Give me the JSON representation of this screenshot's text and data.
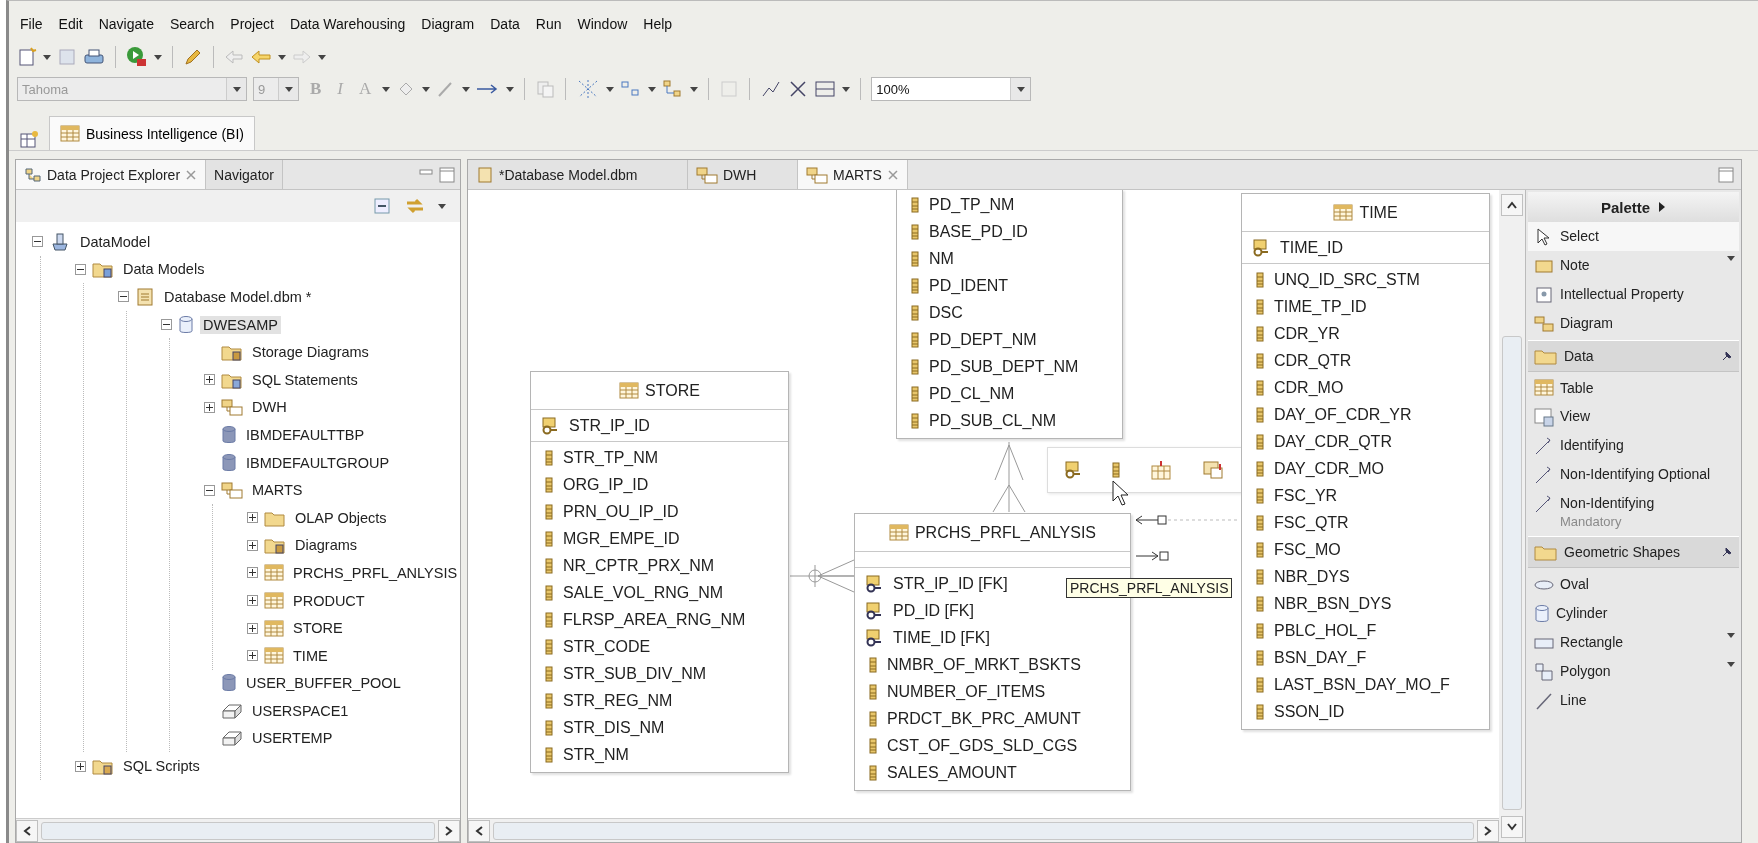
{
  "menu": [
    "File",
    "Edit",
    "Navigate",
    "Search",
    "Project",
    "Data Warehousing",
    "Diagram",
    "Data",
    "Run",
    "Window",
    "Help"
  ],
  "toolbar": {
    "font": "Tahoma",
    "size": "9",
    "format_buttons": [
      {
        "label": "B",
        "kind": "bold",
        "disabled": true
      },
      {
        "label": "I",
        "kind": "italic",
        "disabled": true
      },
      {
        "label": "A",
        "kind": "font",
        "disabled": true
      }
    ],
    "zoom": "100%"
  },
  "perspectives": [
    {
      "label": "Business Intelligence (BI)",
      "selected": true
    }
  ],
  "explorer": {
    "tabs": [
      {
        "label": "Data Project Explorer",
        "selected": true
      },
      {
        "label": "Navigator",
        "selected": false
      }
    ],
    "tree": [
      {
        "label": "DataModel",
        "kind": "project",
        "expanded": true,
        "selected": false,
        "children": [
          {
            "label": "Data Models",
            "kind": "models",
            "expanded": true,
            "selected": false,
            "children": [
              {
                "label": "Database Model.dbm *",
                "kind": "dbm",
                "expanded": true,
                "selected": false,
                "children": [
                  {
                    "label": "DWESAMP",
                    "kind": "database",
                    "expanded": true,
                    "selected": true,
                    "children": [
                      {
                        "label": "Storage Diagrams",
                        "kind": "diagrams",
                        "selected": false
                      },
                      {
                        "label": "SQL Statements",
                        "kind": "sql",
                        "expanded": false,
                        "selected": false
                      },
                      {
                        "label": "DWH",
                        "kind": "schema",
                        "expanded": false,
                        "selected": false
                      },
                      {
                        "label": "IBMDEFAULTTBP",
                        "kind": "bufferpool",
                        "selected": false
                      },
                      {
                        "label": "IBMDEFAULTGROUP",
                        "kind": "group",
                        "selected": false
                      },
                      {
                        "label": "MARTS",
                        "kind": "schema",
                        "expanded": true,
                        "selected": false,
                        "children": [
                          {
                            "label": "OLAP Objects",
                            "kind": "folder",
                            "expanded": false,
                            "selected": false
                          },
                          {
                            "label": "Diagrams",
                            "kind": "diagrams",
                            "expanded": false,
                            "selected": false
                          },
                          {
                            "label": "PRCHS_PRFL_ANLYSIS",
                            "kind": "table",
                            "expanded": false,
                            "selected": false
                          },
                          {
                            "label": "PRODUCT",
                            "kind": "table",
                            "expanded": false,
                            "selected": false
                          },
                          {
                            "label": "STORE",
                            "kind": "table",
                            "expanded": false,
                            "selected": false
                          },
                          {
                            "label": "TIME",
                            "kind": "table",
                            "expanded": false,
                            "selected": false
                          }
                        ]
                      },
                      {
                        "label": "USER_BUFFER_POOL",
                        "kind": "bufferpool",
                        "selected": false
                      },
                      {
                        "label": "USERSPACE1",
                        "kind": "tablespace",
                        "selected": false
                      },
                      {
                        "label": "USERTEMP",
                        "kind": "tablespace",
                        "selected": false
                      }
                    ]
                  }
                ]
              }
            ]
          },
          {
            "label": "SQL Scripts",
            "kind": "scripts",
            "expanded": false,
            "selected": false
          }
        ]
      }
    ]
  },
  "editor_tabs": [
    {
      "label": "*Database Model.dbm",
      "kind": "model",
      "selected": false
    },
    {
      "label": "DWH",
      "kind": "diagram",
      "selected": false
    },
    {
      "label": "MARTS",
      "kind": "diagram",
      "selected": true
    }
  ],
  "diagram": {
    "tables": [
      {
        "kind": "cut",
        "columns": [
          {
            "name": "PD_TP_NM",
            "kind": "col"
          },
          {
            "name": "BASE_PD_ID",
            "kind": "col"
          },
          {
            "name": "NM",
            "kind": "col"
          },
          {
            "name": "PD_IDENT",
            "kind": "col"
          },
          {
            "name": "DSC",
            "kind": "col"
          },
          {
            "name": "PD_DEPT_NM",
            "kind": "col"
          },
          {
            "name": "PD_SUB_DEPT_NM",
            "kind": "col"
          },
          {
            "name": "PD_CL_NM",
            "kind": "col"
          },
          {
            "name": "PD_SUB_CL_NM",
            "kind": "col"
          }
        ]
      },
      {
        "kind": "full",
        "title": "STORE",
        "columns": [
          {
            "name": "STR_IP_ID",
            "kind": "pk"
          },
          {
            "name": "STR_TP_NM",
            "kind": "col"
          },
          {
            "name": "ORG_IP_ID",
            "kind": "col"
          },
          {
            "name": "PRN_OU_IP_ID",
            "kind": "col"
          },
          {
            "name": "MGR_EMPE_ID",
            "kind": "col"
          },
          {
            "name": "NR_CPTR_PRX_NM",
            "kind": "col"
          },
          {
            "name": "SALE_VOL_RNG_NM",
            "kind": "col"
          },
          {
            "name": "FLRSP_AREA_RNG_NM",
            "kind": "col"
          },
          {
            "name": "STR_CODE",
            "kind": "col"
          },
          {
            "name": "STR_SUB_DIV_NM",
            "kind": "col"
          },
          {
            "name": "STR_REG_NM",
            "kind": "col"
          },
          {
            "name": "STR_DIS_NM",
            "kind": "col"
          },
          {
            "name": "STR_NM",
            "kind": "col"
          }
        ]
      },
      {
        "kind": "full",
        "title": "PRCHS_PRFL_ANLYSIS",
        "columns": [
          {
            "name": "STR_IP_ID [FK]",
            "kind": "fk"
          },
          {
            "name": "PD_ID [FK]",
            "kind": "fk"
          },
          {
            "name": "TIME_ID [FK]",
            "kind": "fk"
          },
          {
            "name": "NMBR_OF_MRKT_BSKTS",
            "kind": "col"
          },
          {
            "name": "NUMBER_OF_ITEMS",
            "kind": "col"
          },
          {
            "name": "PRDCT_BK_PRC_AMUNT",
            "kind": "col"
          },
          {
            "name": "CST_OF_GDS_SLD_CGS",
            "kind": "col"
          },
          {
            "name": "SALES_AMOUNT",
            "kind": "col"
          }
        ]
      },
      {
        "kind": "full",
        "title": "TIME",
        "columns": [
          {
            "name": "TIME_ID",
            "kind": "pk"
          },
          {
            "name": "UNQ_ID_SRC_STM",
            "kind": "col"
          },
          {
            "name": "TIME_TP_ID",
            "kind": "col"
          },
          {
            "name": "CDR_YR",
            "kind": "col"
          },
          {
            "name": "CDR_QTR",
            "kind": "col"
          },
          {
            "name": "CDR_MO",
            "kind": "col"
          },
          {
            "name": "DAY_OF_CDR_YR",
            "kind": "col"
          },
          {
            "name": "DAY_CDR_QTR",
            "kind": "col"
          },
          {
            "name": "DAY_CDR_MO",
            "kind": "col"
          },
          {
            "name": "FSC_YR",
            "kind": "col"
          },
          {
            "name": "FSC_QTR",
            "kind": "col"
          },
          {
            "name": "FSC_MO",
            "kind": "col"
          },
          {
            "name": "NBR_DYS",
            "kind": "col"
          },
          {
            "name": "NBR_BSN_DYS",
            "kind": "col"
          },
          {
            "name": "PBLC_HOL_F",
            "kind": "col"
          },
          {
            "name": "BSN_DAY_F",
            "kind": "col"
          },
          {
            "name": "LAST_BSN_DAY_MO_F",
            "kind": "col"
          },
          {
            "name": "SSON_ID",
            "kind": "col"
          }
        ]
      }
    ],
    "tooltip": "PRCHS_PRFL_ANLYSIS"
  },
  "palette": {
    "title": "Palette",
    "entries": [
      {
        "kind": "tool",
        "label": "Select",
        "selected": true,
        "dropdown": false
      },
      {
        "kind": "tool",
        "label": "Note",
        "selected": false,
        "dropdown": true
      },
      {
        "kind": "tool",
        "label": "Intellectual Property",
        "selected": false,
        "dropdown": false
      },
      {
        "kind": "tool",
        "label": "Diagram",
        "selected": false,
        "dropdown": false
      },
      {
        "kind": "drawer",
        "label": "Data",
        "pinned": true
      },
      {
        "kind": "tool",
        "label": "Table",
        "selected": false,
        "dropdown": false
      },
      {
        "kind": "tool",
        "label": "View",
        "selected": false,
        "dropdown": false
      },
      {
        "kind": "tool",
        "label": "Identifying",
        "selected": false,
        "dropdown": false
      },
      {
        "kind": "tool",
        "label": "Non-Identifying Optional",
        "selected": false,
        "dropdown": false
      },
      {
        "kind": "tool",
        "label": "Non-Identifying",
        "faded": "Mandatory",
        "selected": false,
        "dropdown": false
      },
      {
        "kind": "drawer",
        "label": "Geometric Shapes",
        "pinned": true
      },
      {
        "kind": "tool",
        "label": "Oval",
        "selected": false,
        "dropdown": false
      },
      {
        "kind": "tool",
        "label": "Cylinder",
        "selected": false,
        "dropdown": false
      },
      {
        "kind": "tool",
        "label": "Rectangle",
        "selected": false,
        "dropdown": true
      },
      {
        "kind": "tool",
        "label": "Polygon",
        "selected": false,
        "dropdown": true
      },
      {
        "kind": "tool",
        "label": "Line",
        "selected": false,
        "dropdown": false
      }
    ]
  }
}
